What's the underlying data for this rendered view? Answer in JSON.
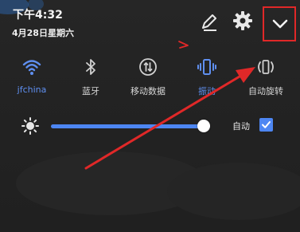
{
  "status": {
    "time": "下午4:32",
    "date": "4月28日星期六"
  },
  "header": {
    "edit_icon": "pencil-icon",
    "settings_icon": "gear-icon",
    "collapse_icon": "chevron-down-icon"
  },
  "tiles": [
    {
      "label": "jfchina",
      "icon": "wifi-icon",
      "active": true
    },
    {
      "label": "蓝牙",
      "icon": "bluetooth-icon",
      "active": false
    },
    {
      "label": "移动数据",
      "icon": "mobile-data-icon",
      "active": false
    },
    {
      "label": "振动",
      "icon": "vibrate-icon",
      "active": true
    },
    {
      "label": "自动旋转",
      "icon": "auto-rotate-icon",
      "active": false
    }
  ],
  "brightness": {
    "icon": "brightness-icon",
    "level": 0.96,
    "auto_label": "自动",
    "auto_checked": true
  },
  "colors": {
    "accent": "#4d86f2",
    "annotation": "#e02828",
    "background": "#232323"
  }
}
